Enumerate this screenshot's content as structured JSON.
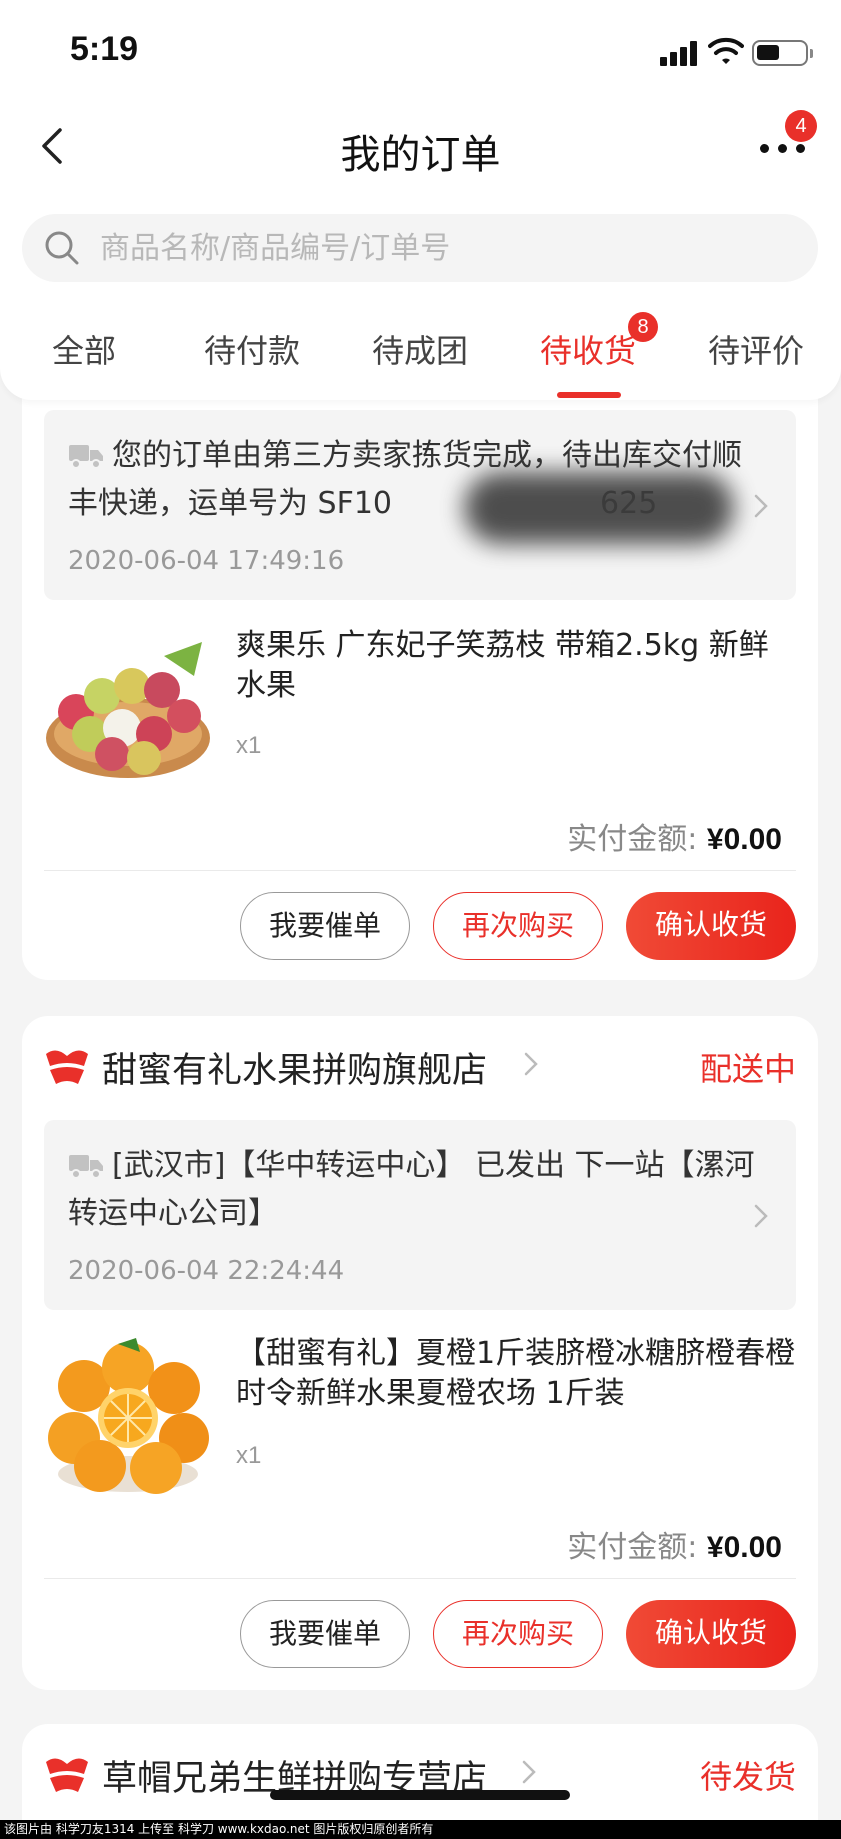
{
  "status_bar": {
    "time": "5:19"
  },
  "nav": {
    "title": "我的订单",
    "more_badge": "4"
  },
  "search": {
    "placeholder": "商品名称/商品编号/订单号",
    "value": ""
  },
  "tabs": [
    {
      "label": "全部"
    },
    {
      "label": "待付款"
    },
    {
      "label": "待成团"
    },
    {
      "label": "待收货",
      "active": true,
      "badge": "8"
    },
    {
      "label": "待评价"
    }
  ],
  "orders": [
    {
      "logistics_text": "您的订单由第三方卖家拣货完成，待出库交付顺丰快递，运单号为 SF10",
      "logistics_tail": "625",
      "logistics_time": "2020-06-04 17:49:16",
      "product_name": "爽果乐 广东妃子笑荔枝 带箱2.5kg 新鲜水果",
      "qty": "x1",
      "pay_label": "实付金额:",
      "pay_amount": "¥0.00",
      "buttons": {
        "urge": "我要催单",
        "rebuy": "再次购买",
        "confirm": "确认收货"
      }
    },
    {
      "store_name": "甜蜜有礼水果拼购旗舰店",
      "status": "配送中",
      "logistics_text": "[武汉市]【华中转运中心】 已发出 下一站【漯河转运中心公司】",
      "logistics_time": "2020-06-04 22:24:44",
      "product_name": "【甜蜜有礼】夏橙1斤装脐橙冰糖脐橙春橙时令新鲜水果夏橙农场 1斤装",
      "qty": "x1",
      "pay_label": "实付金额:",
      "pay_amount": "¥0.00",
      "buttons": {
        "urge": "我要催单",
        "rebuy": "再次购买",
        "confirm": "确认收货"
      }
    },
    {
      "store_name": "草帽兄弟生鲜拼购专营店",
      "status": "待发货"
    }
  ],
  "colors": {
    "accent": "#e9302a",
    "background": "#f4f4f4"
  },
  "watermark": "该图片由 科学刀友1314 上传至 科学刀 www.kxdao.net 图片版权归原创者所有"
}
